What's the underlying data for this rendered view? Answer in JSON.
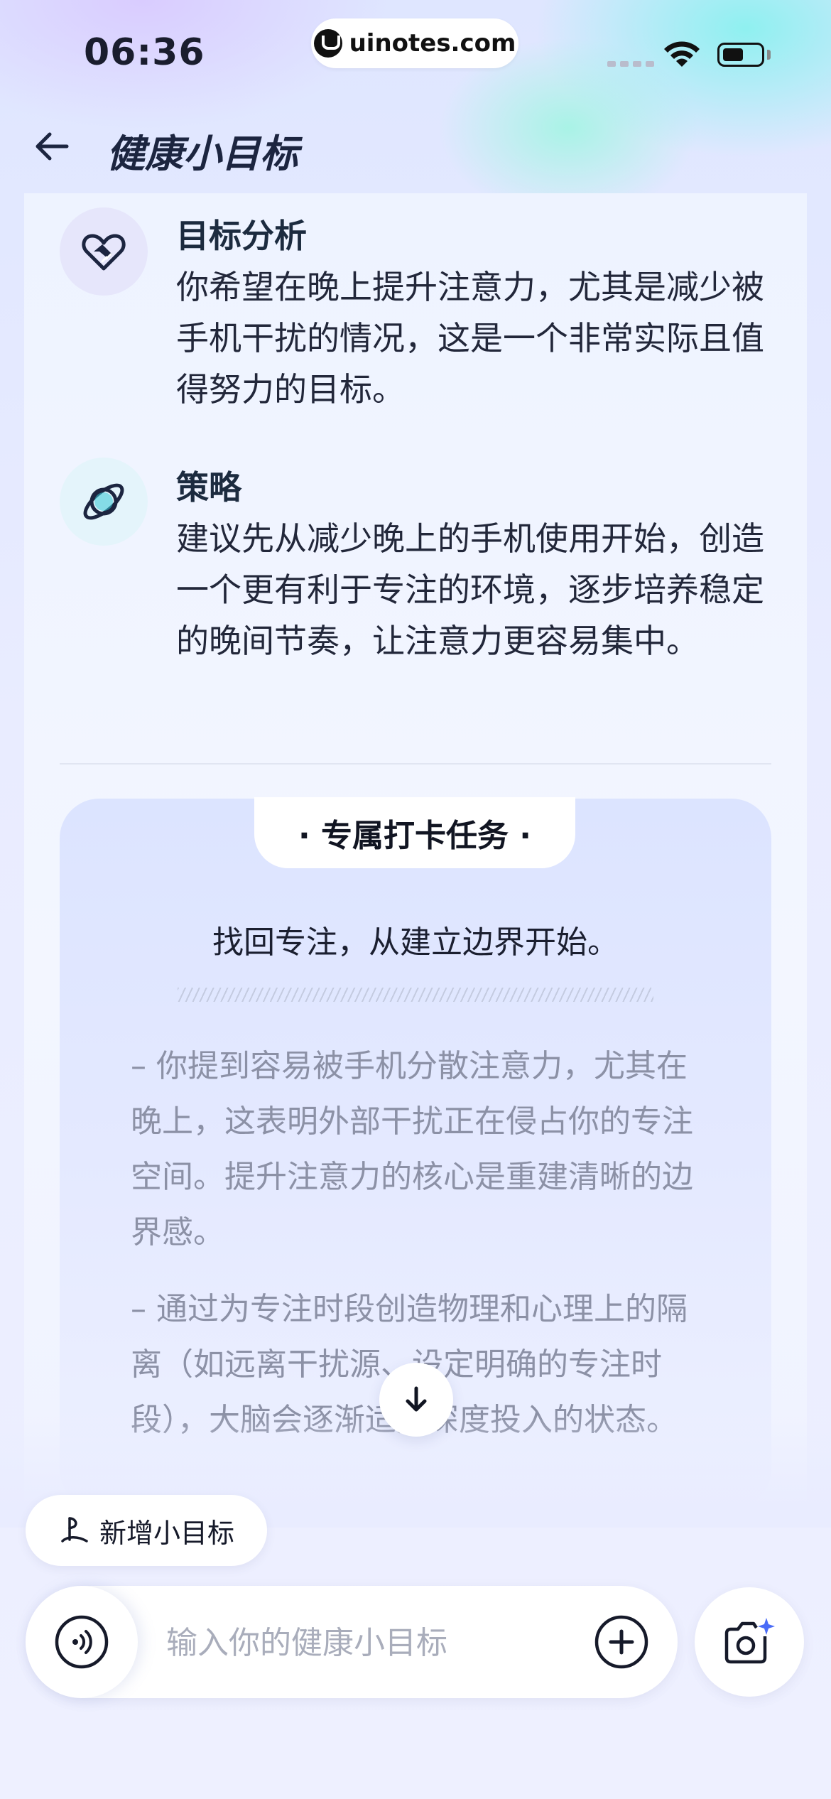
{
  "status_bar": {
    "time": "06:36",
    "url": "uinotes.com"
  },
  "header": {
    "title": "健康小目标"
  },
  "goal_analysis": {
    "title": "目标分析",
    "body": "你希望在晚上提升注意力，尤其是减少被手机干扰的情况，这是一个非常实际且值得努力的目标。"
  },
  "strategy": {
    "title": "策略",
    "body": "建议先从减少晚上的手机使用开始，创造一个更有利于专注的环境，逐步培养稳定的晚间节奏，让注意力更容易集中。"
  },
  "task_card": {
    "tab_label": "· 专属打卡任务 ·",
    "headline": "找回专注，从建立边界开始。",
    "paragraphs": [
      "– 你提到容易被手机分散注意力，尤其在晚上，这表明外部干扰正在侵占你的专注空间。提升注意力的核心是重建清晰的边界感。",
      "– 通过为专注时段创造物理和心理上的隔离（如远离干扰源、设定明确的专注时段），大脑会逐渐适应深度投入的状态。"
    ]
  },
  "actions": {
    "new_goal_label": "新增小目标",
    "input_placeholder": "输入你的健康小目标"
  },
  "icons": {
    "back": "arrow-left-icon",
    "goal_analysis": "heart-handshake-icon",
    "strategy": "orbit-icon",
    "scroll_down": "arrow-down-icon",
    "new_goal": "goal-flag-icon",
    "voice": "voice-wave-icon",
    "plus": "plus-circle-icon",
    "camera": "camera-sparkle-icon"
  },
  "colors": {
    "accent_cyan": "#37c9d6",
    "accent_blue": "#4a6cf7",
    "text_dark": "#1c2b3f",
    "text_muted": "#8c91a6"
  }
}
